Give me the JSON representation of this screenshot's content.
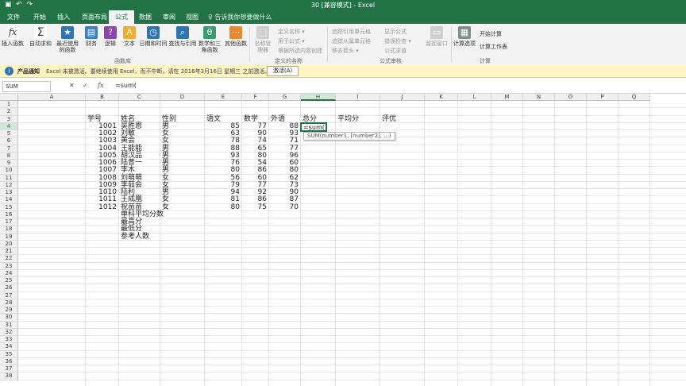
{
  "window": {
    "qat_icons": [
      "save-icon",
      "undo-icon",
      "redo-icon"
    ],
    "title": "30 [兼容模式] - Excel"
  },
  "tabs": [
    {
      "label": "文件"
    },
    {
      "label": "开始"
    },
    {
      "label": "插入"
    },
    {
      "label": "页面布局"
    },
    {
      "label": "公式",
      "active": true
    },
    {
      "label": "数据"
    },
    {
      "label": "审阅"
    },
    {
      "label": "视图"
    }
  ],
  "tell_me": "♀ 告诉我你想要做什么",
  "ribbon": {
    "function_library": {
      "label": "函数库",
      "buttons": [
        {
          "glyph": "fx",
          "label": "插入函数"
        },
        {
          "glyph": "Σ",
          "label": "自动求和"
        },
        {
          "glyph": "★",
          "label": "最近使用的函数"
        },
        {
          "glyph": "▤",
          "label": "财务"
        },
        {
          "glyph": "?",
          "label": "逻辑"
        },
        {
          "glyph": "A",
          "label": "文本"
        },
        {
          "glyph": "◷",
          "label": "日期和时间"
        },
        {
          "glyph": "⌕",
          "label": "查找与引用"
        },
        {
          "glyph": "θ",
          "label": "数学和三角函数"
        },
        {
          "glyph": "⋯",
          "label": "其他函数"
        }
      ]
    },
    "defined_names": {
      "label": "定义的名称",
      "manager": "名称管理器",
      "items": [
        "定义名称 ▾",
        "用于公式 ▾",
        "根据所选内容创建"
      ]
    },
    "formula_auditing": {
      "label": "公式审核",
      "items": [
        "追踪引用单元格",
        "追踪从属单元格",
        "移去箭头 ▾",
        "显示公式",
        "错误检查 ▾",
        "公式求值"
      ],
      "watch": "监视窗口"
    },
    "calculation": {
      "label": "计算",
      "options": "计算选项",
      "items": [
        "开始计算",
        "计算工作表"
      ]
    }
  },
  "infobar": {
    "label": "产品通知",
    "message": "Excel 未被激活。要继续使用 Excel，而不中断，请在 2016年3月16日 星期三 之前激活。",
    "action": "激活(A)"
  },
  "formula_bar": {
    "name_box": "SUM",
    "formula": "=sum("
  },
  "sheet": {
    "columns": [
      "A",
      "B",
      "C",
      "D",
      "E",
      "F",
      "G",
      "H",
      "I",
      "J",
      "K",
      "L",
      "M",
      "N",
      "O",
      "P",
      "Q"
    ],
    "selected_column": "H",
    "row_count": 38,
    "selected_row": 4,
    "headers": {
      "id": "学号",
      "name": "姓名",
      "gender": "性别",
      "chinese": "语文",
      "math": "数学",
      "english": "外语",
      "total": "总分",
      "average": "平均分",
      "rating": "评优"
    },
    "students": [
      {
        "id": "1001",
        "name": "吴胜恩",
        "gender": "男",
        "chinese": "85",
        "math": "77",
        "english": "88"
      },
      {
        "id": "1002",
        "name": "刘敏",
        "gender": "女",
        "chinese": "63",
        "math": "90",
        "english": "93"
      },
      {
        "id": "1003",
        "name": "黄会",
        "gender": "女",
        "chinese": "78",
        "math": "74",
        "english": "71"
      },
      {
        "id": "1004",
        "name": "王能能",
        "gender": "男",
        "chinese": "88",
        "math": "65",
        "english": "77"
      },
      {
        "id": "1005",
        "name": "胡汉品",
        "gender": "男",
        "chinese": "93",
        "math": "80",
        "english": "96"
      },
      {
        "id": "1006",
        "name": "陆昔一",
        "gender": "男",
        "chinese": "76",
        "math": "54",
        "english": "60"
      },
      {
        "id": "1007",
        "name": "李木",
        "gender": "男",
        "chinese": "80",
        "math": "86",
        "english": "80"
      },
      {
        "id": "1008",
        "name": "刘萌萌",
        "gender": "女",
        "chinese": "56",
        "math": "60",
        "english": "62"
      },
      {
        "id": "1009",
        "name": "李茹会",
        "gender": "女",
        "chinese": "79",
        "math": "77",
        "english": "73"
      },
      {
        "id": "1010",
        "name": "陆利",
        "gender": "男",
        "chinese": "94",
        "math": "92",
        "english": "90"
      },
      {
        "id": "1011",
        "name": "王成凰",
        "gender": "女",
        "chinese": "81",
        "math": "86",
        "english": "87"
      },
      {
        "id": "1012",
        "name": "祝苗苗",
        "gender": "女",
        "chinese": "80",
        "math": "75",
        "english": "70"
      }
    ],
    "summary_labels": [
      "单科平均分数",
      "最高分",
      "最低分",
      "参考人数"
    ],
    "active_cell_text": "=sum(",
    "tooltip": "SUM(number1, [number2], ...)"
  },
  "colors": {
    "accent": "#217346"
  }
}
